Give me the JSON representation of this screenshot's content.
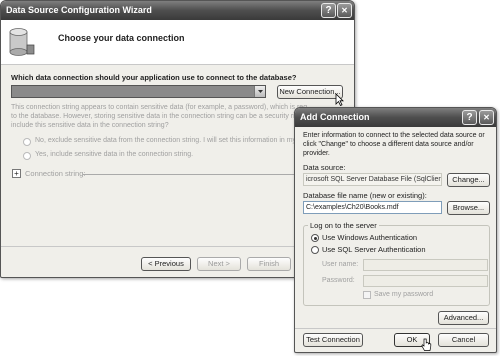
{
  "wizard": {
    "title": "Data Source Configuration Wizard",
    "help_btn": "?",
    "close_btn": "✕",
    "header": "Choose your data connection",
    "question": "Which data connection should your application use to connect to the database?",
    "new_connection_btn": "New Connection...",
    "sensitive_line1": "This connection string appears to contain sensitive data (for example, a password), which is req",
    "sensitive_line2": "to the database. However, storing sensitive data in the connection string can be a security risk.",
    "sensitive_line3": "include this sensitive data in the connection string?",
    "radio_exclude": "No, exclude sensitive data from the connection string. I will set this information in my ap",
    "radio_include": "Yes, include sensitive data in the connection string.",
    "connection_string_label": "Connection string:",
    "expander": "+",
    "prev_btn": "< Previous",
    "next_btn": "Next >",
    "finish_btn": "Finish"
  },
  "dialog": {
    "title": "Add Connection",
    "help_btn": "?",
    "close_btn": "✕",
    "intro_line1": "Enter information to connect to the selected data source or",
    "intro_line2": "click \"Change\" to choose a different data source and/or",
    "intro_line3": "provider.",
    "data_source_label": "Data source:",
    "data_source_value": "icrosoft SQL Server Database File (SqlClient)",
    "change_btn": "Change...",
    "db_file_label": "Database file name (new or existing):",
    "db_file_value": "C:\\examples\\Ch20\\Books.mdf",
    "browse_btn": "Browse...",
    "logon_group": "Log on to the server",
    "radio_windows": "Use Windows Authentication",
    "radio_sql": "Use SQL Server Authentication",
    "user_label": "User name:",
    "password_label": "Password:",
    "save_password": "Save my password",
    "advanced_btn": "Advanced...",
    "test_btn": "Test Connection",
    "ok_btn": "OK",
    "cancel_btn": "Cancel"
  }
}
